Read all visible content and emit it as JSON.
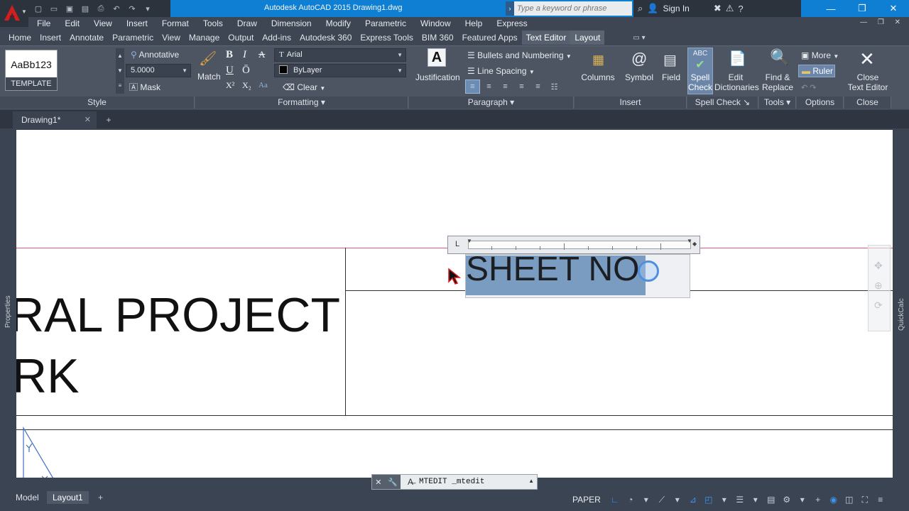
{
  "title_bar": {
    "title": "Autodesk AutoCAD 2015   Drawing1.dwg",
    "search_placeholder": "Type a keyword or phrase",
    "sign_in": "Sign In"
  },
  "menu": [
    "File",
    "Edit",
    "View",
    "Insert",
    "Format",
    "Tools",
    "Draw",
    "Dimension",
    "Modify",
    "Parametric",
    "Window",
    "Help",
    "Express"
  ],
  "ribbon_tabs": [
    "Home",
    "Insert",
    "Annotate",
    "Parametric",
    "View",
    "Manage",
    "Output",
    "Add-ins",
    "Autodesk 360",
    "Express Tools",
    "BIM 360",
    "Featured Apps",
    "Text Editor",
    "Layout"
  ],
  "style_panel": {
    "preview_sample": "AaBb123",
    "style_name": "TEMPLATE",
    "annotative": "Annotative",
    "height_value": "5.0000",
    "mask": "Mask",
    "footer": "Style"
  },
  "formatting_panel": {
    "match": "Match",
    "bold": "B",
    "italic": "I",
    "strike": "A",
    "underline": "U",
    "overline": "Ō",
    "superscript": "X²",
    "subscript": "X₂",
    "case": "Aa",
    "font": "Arial",
    "color": "ByLayer",
    "clear": "Clear",
    "footer": "Formatting"
  },
  "paragraph_panel": {
    "justification": "Justification",
    "bullets": "Bullets and Numbering",
    "line_spacing": "Line Spacing",
    "footer": "Paragraph"
  },
  "insert_panel": {
    "columns": "Columns",
    "symbol": "Symbol",
    "field": "Field",
    "footer": "Insert"
  },
  "spell_panel": {
    "spell_check_1": "Spell",
    "spell_check_2": "Check",
    "edit_dict_1": "Edit",
    "edit_dict_2": "Dictionaries",
    "footer": "Spell Check"
  },
  "tools_panel": {
    "find_1": "Find &",
    "find_2": "Replace",
    "footer": "Tools"
  },
  "options_panel": {
    "more": "More",
    "ruler": "Ruler",
    "footer": "Options"
  },
  "close_panel": {
    "close_1": "Close",
    "close_2": "Text Editor",
    "footer": "Close"
  },
  "document_tab": "Drawing1*",
  "drawing": {
    "line1": "RAL PROJECT",
    "line2": "RK",
    "mtext": "SHEET NO"
  },
  "side_palettes": {
    "left": "Properties",
    "right": "QuickCalc"
  },
  "command_line": "MTEDIT _mtedit",
  "status_bar": {
    "model": "Model",
    "layout": "Layout1",
    "paper": "PAPER"
  },
  "colors": {
    "title_bar": "#0f7fd4",
    "ribbon": "#4d5563",
    "selection": "#7a9cc0",
    "accent_on": "#6b86a8"
  }
}
